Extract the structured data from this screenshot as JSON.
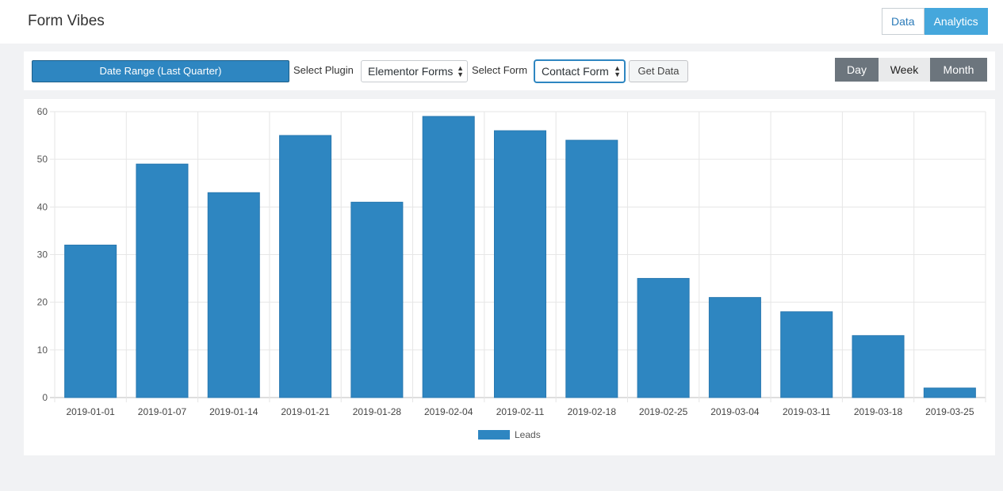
{
  "header": {
    "title": "Form Vibes",
    "tabs": [
      {
        "label": "Data",
        "active": false
      },
      {
        "label": "Analytics",
        "active": true
      }
    ]
  },
  "toolbar": {
    "date_range_label": "Date Range (Last Quarter)",
    "plugin_label": "Select Plugin",
    "plugin_value": "Elementor Forms",
    "form_label": "Select Form",
    "form_value": "Contact Form",
    "get_data_label": "Get Data",
    "periods": [
      {
        "label": "Day",
        "active": false
      },
      {
        "label": "Week",
        "active": true
      },
      {
        "label": "Month",
        "active": false
      }
    ]
  },
  "colors": {
    "accent": "#2e86c1",
    "tab_active": "#45a7dc",
    "period_button": "#6c757d"
  },
  "chart_data": {
    "type": "bar",
    "categories": [
      "2019-01-01",
      "2019-01-07",
      "2019-01-14",
      "2019-01-21",
      "2019-01-28",
      "2019-02-04",
      "2019-02-11",
      "2019-02-18",
      "2019-02-25",
      "2019-03-04",
      "2019-03-11",
      "2019-03-18",
      "2019-03-25"
    ],
    "series": [
      {
        "name": "Leads",
        "values": [
          32,
          49,
          43,
          55,
          41,
          59,
          56,
          54,
          25,
          21,
          18,
          13,
          2
        ],
        "color": "#2e86c1"
      }
    ],
    "ylim": [
      0,
      60
    ],
    "yticks": [
      0,
      10,
      20,
      30,
      40,
      50,
      60
    ],
    "grid": true,
    "legend": "bottom-center"
  }
}
